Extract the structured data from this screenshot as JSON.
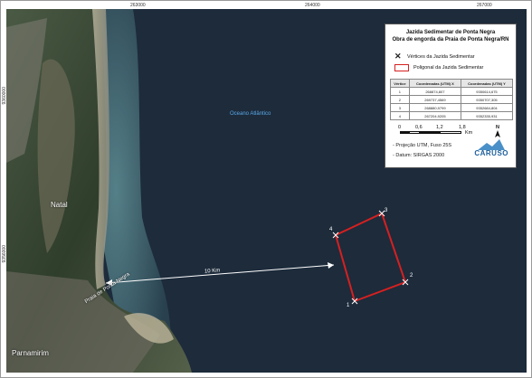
{
  "grid_labels": {
    "top": [
      "263000",
      "264000",
      "267000"
    ],
    "left": [
      "9360000",
      "9356000"
    ]
  },
  "map": {
    "ocean_label": "Oceano Atlântico",
    "city_natal": "Natal",
    "city_parnamirim": "Parnamirim",
    "beach_label": "Praia de Ponta Negra",
    "distance_label": "10 Km",
    "vertex_labels": [
      "1",
      "2",
      "3",
      "4"
    ],
    "colors": {
      "ocean": "#1c2a3a",
      "land": "#3b4a34",
      "polygon": "#d62020",
      "arrow": "#ffffff"
    }
  },
  "legend": {
    "title_line1": "Jazida Sedimentar de Ponta Negra",
    "title_line2": "Obra de engorda da Praia de Ponta Negra/RN",
    "item_vertices": "Vértices da Jazida Sedimentar",
    "item_polygon": "Poligonal da Jazida Sedimentar",
    "table": {
      "headers": [
        "Vértice",
        "Coordenadas (UTM) X",
        "Coordenadas (UTM) Y"
      ],
      "rows": [
        [
          "1",
          "268874,807",
          "9350614,675"
        ],
        [
          "2",
          "269737,4569",
          "9350707,305"
        ],
        [
          "3",
          "268880,9799",
          "9352684,804"
        ],
        [
          "4",
          "267204,9205",
          "9352335,931"
        ]
      ]
    },
    "scale": {
      "ticks": [
        "0",
        "0,6",
        "1,2",
        "1,8"
      ],
      "unit": "Km"
    },
    "north_label": "N",
    "projection": "- Projeção UTM, Fuso 25S",
    "datum": "- Datum: SIRGAS 2000",
    "brand": "CARUSO"
  }
}
